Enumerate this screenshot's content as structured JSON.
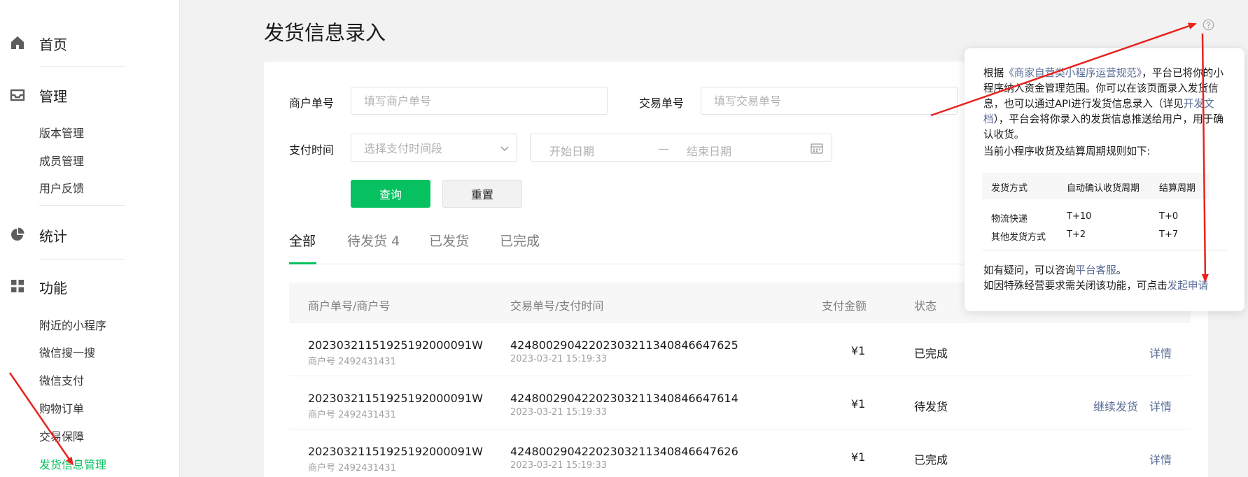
{
  "sidebar": {
    "home": {
      "label": "首页",
      "icon": "home-icon"
    },
    "manage": {
      "label": "管理",
      "icon": "inbox-icon",
      "items": [
        "版本管理",
        "成员管理",
        "用户反馈"
      ]
    },
    "stats": {
      "label": "统计",
      "icon": "pie-chart-icon"
    },
    "features": {
      "label": "功能",
      "icon": "grid-icon",
      "items": [
        "附近的小程序",
        "微信搜一搜",
        "微信支付",
        "购物订单",
        "交易保障",
        "发货信息管理"
      ]
    },
    "active_item": "发货信息管理"
  },
  "page": {
    "title": "发货信息录入"
  },
  "filters": {
    "merchant_no": {
      "label": "商户单号",
      "placeholder": "填写商户单号"
    },
    "trade_no": {
      "label": "交易单号",
      "placeholder": "填写交易单号"
    },
    "pay_time": {
      "label": "支付时间",
      "select_placeholder": "选择支付时间段",
      "start_placeholder": "开始日期",
      "separator": "—",
      "end_placeholder": "结束日期"
    },
    "query_button": "查询",
    "reset_button": "重置"
  },
  "tabs": [
    {
      "label": "全部",
      "active": true
    },
    {
      "label": "待发货 4",
      "active": false
    },
    {
      "label": "已发货",
      "active": false
    },
    {
      "label": "已完成",
      "active": false
    }
  ],
  "table": {
    "headers": [
      "商户单号/商户号",
      "交易单号/支付时间",
      "支付金额",
      "状态"
    ],
    "rows": [
      {
        "merchant_order": "20230321151925192000091W",
        "merchant_id": "商户号 2492431431",
        "trade_no": "4248002904220230321134084664762​5",
        "pay_time": "2023-03-21 15:19:33",
        "amount": "¥1",
        "status": "已完成",
        "actions": [
          "详情"
        ]
      },
      {
        "merchant_order": "20230321151925192000091W",
        "merchant_id": "商户号 2492431431",
        "trade_no": "42480029042202303211340846647614",
        "pay_time": "2023-03-21 15:19:33",
        "amount": "¥1",
        "status": "待发货",
        "actions": [
          "继续发货",
          "详情"
        ]
      },
      {
        "merchant_order": "20230321151925192000091W",
        "merchant_id": "商户号 2492431431",
        "trade_no": "42480029042202303211340846647626",
        "pay_time": "2023-03-21 15:19:33",
        "amount": "¥1",
        "status": "已完成",
        "actions": [
          "详情"
        ]
      }
    ]
  },
  "popover": {
    "p1_a": "根据",
    "p1_link": "《商家自营类小程序运营规范》",
    "p1_b": "，平台已将你的小程序纳入资金管理范围。你可以在该页面录入发货信息，也可以通过API进行发货信息录入（详见",
    "p1_link2": "开发文档",
    "p1_c": "），平台会将你录入的发货信息推送给用户，用于确认收货。",
    "p2": "当前小程序收货及结算周期规则如下:",
    "table_headers": [
      "发货方式",
      "自动确认收货周期",
      "结算周期"
    ],
    "table_rows": [
      [
        "物流快递",
        "T+10",
        "T+0"
      ],
      [
        "其他发货方式",
        "T+2",
        "T+7"
      ]
    ],
    "p3_a": "如有疑问，可以咨询",
    "p3_link": "平台客服",
    "p3_b": "。",
    "p4_a": "如因特殊经营要求需关闭该功能，可点击",
    "p4_link": "发起申请"
  },
  "colors": {
    "accent": "#07c160",
    "link": "#576b95",
    "annotation": "#e8231e"
  }
}
